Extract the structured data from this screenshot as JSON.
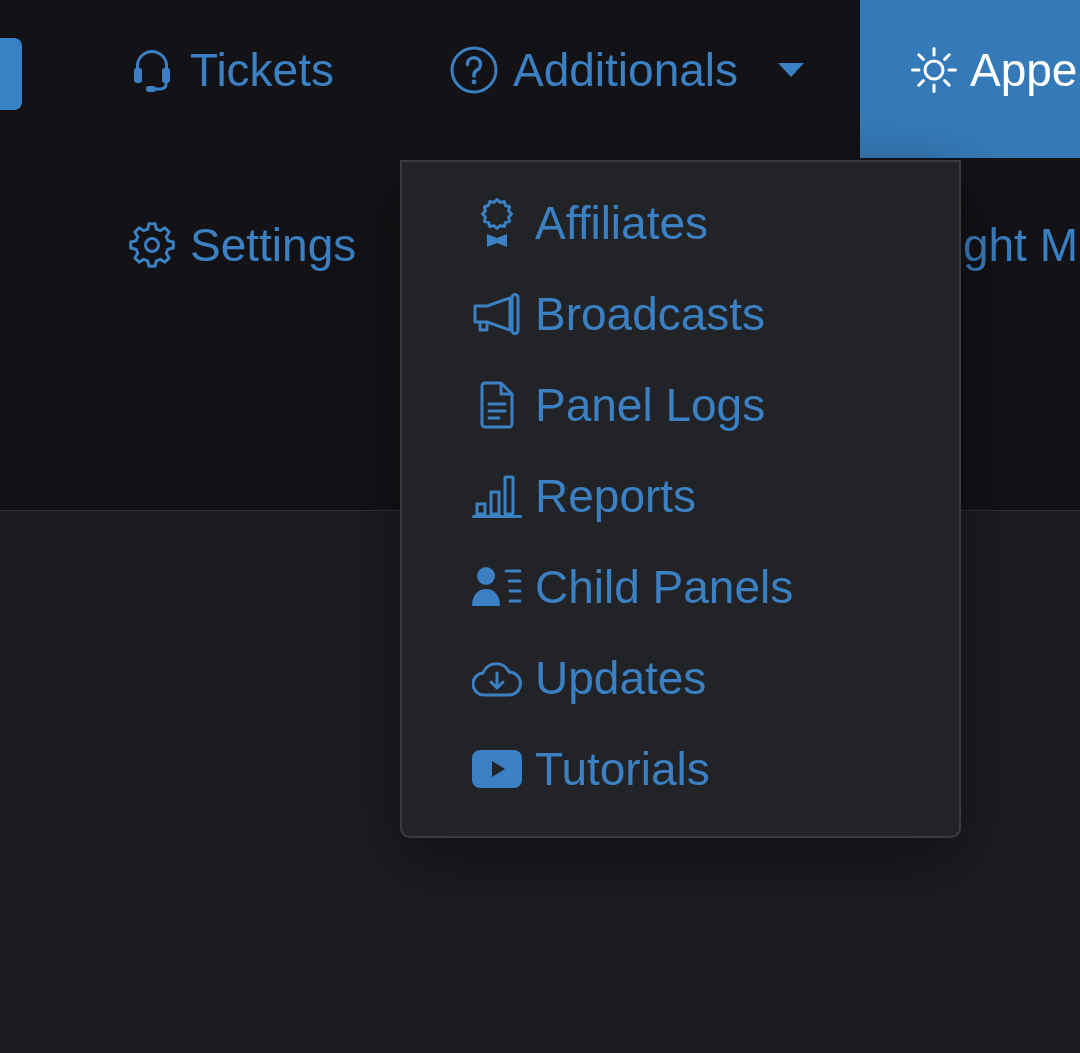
{
  "navbar": {
    "row_1": [
      {
        "kind": "link",
        "label": "Tickets",
        "selected": false
      },
      {
        "kind": "dropdown",
        "label": "Additionals",
        "selected": false,
        "expanded": true,
        "menu": [
          "Affiliates",
          "Broadcasts",
          "Panel Logs",
          "Reports",
          "Child Panels",
          "Updates",
          "Tutorials"
        ]
      },
      {
        "kind": "link",
        "label": "Appe",
        "selected": true
      }
    ],
    "row_2": [
      {
        "label": "Settings",
        "selected": false
      },
      {
        "label": "ght M",
        "selected": false
      }
    ]
  }
}
